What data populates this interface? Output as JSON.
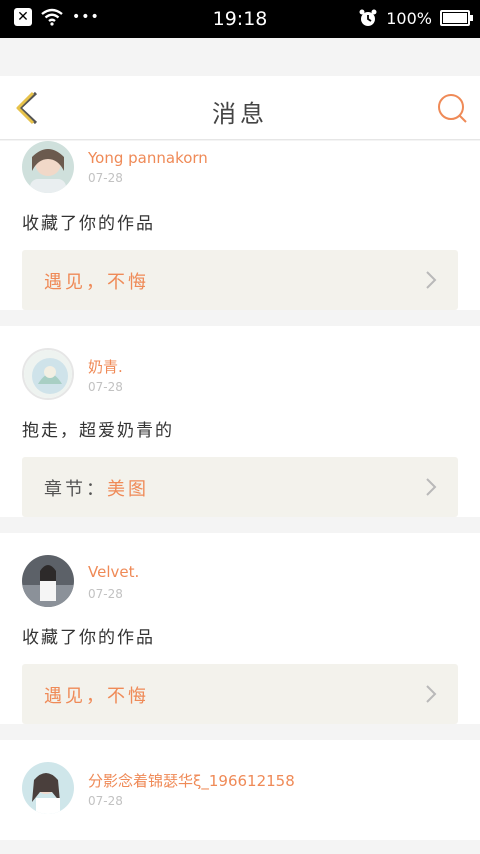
{
  "status_bar": {
    "time": "19:18",
    "battery_text": "100%",
    "dots": "•••"
  },
  "header": {
    "title": "消息"
  },
  "colors": {
    "accent": "#ef8a57",
    "back_yellow": "#e7c24a",
    "quote_bg": "#f3f2ec"
  },
  "messages": [
    {
      "username": "Yong pannakorn",
      "time": "07-28",
      "action": "收藏了你的作品",
      "quote_prefix": "",
      "quote": "遇见，不悔"
    },
    {
      "username": "奶青.",
      "time": "07-28",
      "action": "抱走，超爱奶青的",
      "quote_prefix": "章节：",
      "quote": "美图"
    },
    {
      "username": "Velvet.",
      "time": "07-28",
      "action": "收藏了你的作品",
      "quote_prefix": "",
      "quote": "遇见，不悔"
    },
    {
      "username": "分影念着锦瑟华ξ_196612158",
      "time": "07-28"
    }
  ]
}
